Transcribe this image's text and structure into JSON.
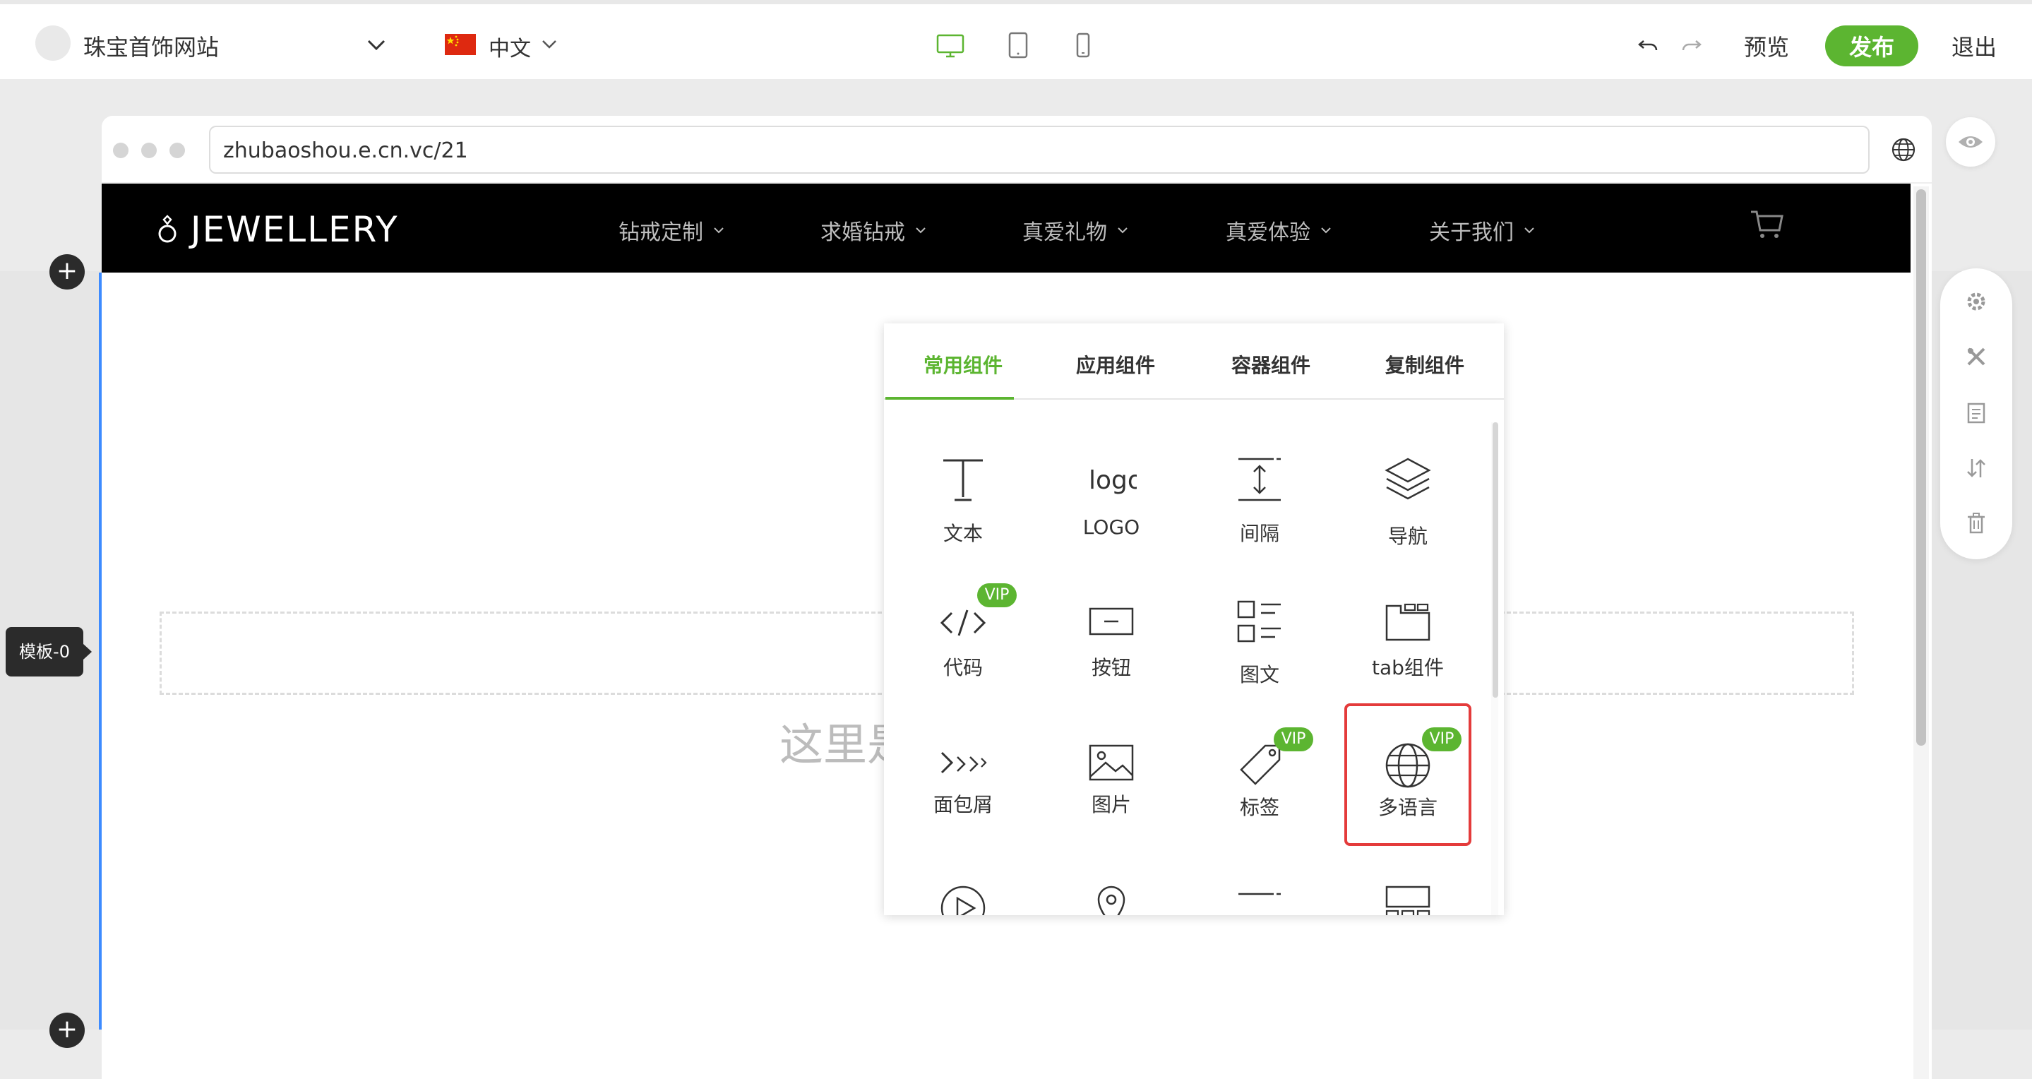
{
  "topbar": {
    "site_name": "珠宝首饰网站",
    "language": "中文",
    "preview": "预览",
    "publish": "发布",
    "exit": "退出",
    "accent_color": "#5cb531"
  },
  "browser": {
    "url": "zhubaoshou.e.cn.vc/21"
  },
  "site": {
    "logo": "JEWELLERY",
    "nav": [
      "钻戒定制",
      "求婚钻戒",
      "真爱礼物",
      "真爱体验",
      "关于我们"
    ]
  },
  "canvas": {
    "module_tag": "模板-0",
    "placeholder": "这里是"
  },
  "picker": {
    "tabs": [
      "常用组件",
      "应用组件",
      "容器组件",
      "复制组件"
    ],
    "active_tab": "常用组件",
    "components": [
      {
        "label": "文本",
        "icon": "text-icon",
        "vip": false
      },
      {
        "label": "LOGO",
        "icon": "logo-icon",
        "vip": false
      },
      {
        "label": "间隔",
        "icon": "spacing-icon",
        "vip": false
      },
      {
        "label": "导航",
        "icon": "layers-icon",
        "vip": false
      },
      {
        "label": "代码",
        "icon": "code-icon",
        "vip": true
      },
      {
        "label": "按钮",
        "icon": "button-icon",
        "vip": false
      },
      {
        "label": "图文",
        "icon": "image-text-icon",
        "vip": false
      },
      {
        "label": "tab组件",
        "icon": "tab-icon",
        "vip": false
      },
      {
        "label": "面包屑",
        "icon": "breadcrumb-icon",
        "vip": false
      },
      {
        "label": "图片",
        "icon": "image-icon",
        "vip": false
      },
      {
        "label": "标签",
        "icon": "tag-icon",
        "vip": true
      },
      {
        "label": "多语言",
        "icon": "globe-icon",
        "vip": true
      }
    ],
    "vip_label": "VIP",
    "logo_glyph": "logo"
  }
}
